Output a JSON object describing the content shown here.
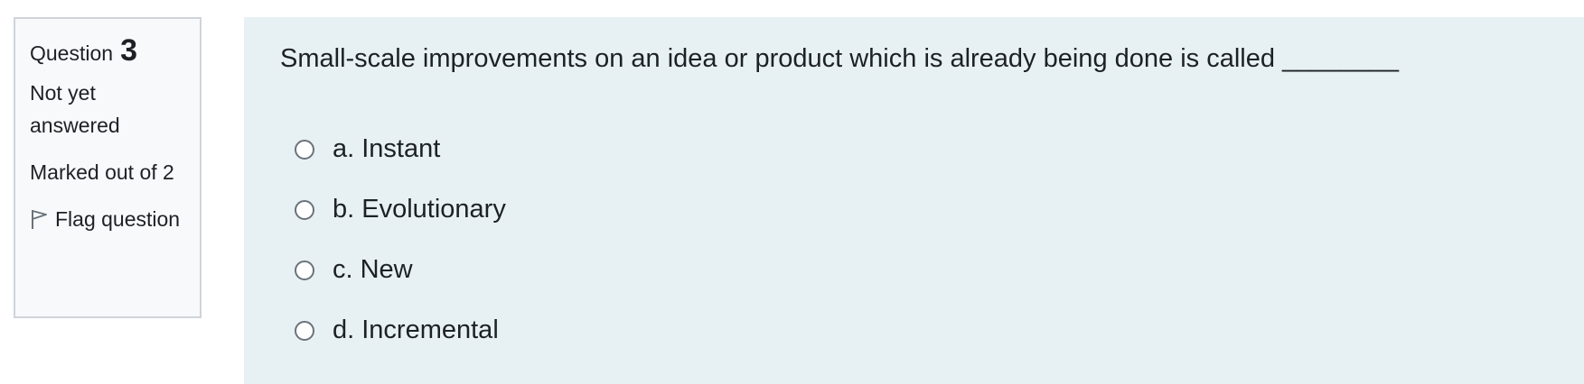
{
  "info": {
    "question_label": "Question",
    "question_number": "3",
    "state": "Not yet answered",
    "grade": "Marked out of 2",
    "flag_label": "Flag question"
  },
  "question": {
    "text": "Small-scale improvements on an idea or product which is already being done is called ________",
    "answers": [
      {
        "label": "a. Instant",
        "selected": false
      },
      {
        "label": "b. Evolutionary",
        "selected": false
      },
      {
        "label": "c. New",
        "selected": false
      },
      {
        "label": "d. Incremental",
        "selected": false
      }
    ]
  },
  "colors": {
    "info_background": "#f8f9fa",
    "info_border": "#cfd4da",
    "content_background": "#e7f1f4",
    "text": "#1d2125",
    "radio_border": "#6a737b"
  },
  "icons": {
    "flag": "flag-icon",
    "radio": "radio-button"
  }
}
